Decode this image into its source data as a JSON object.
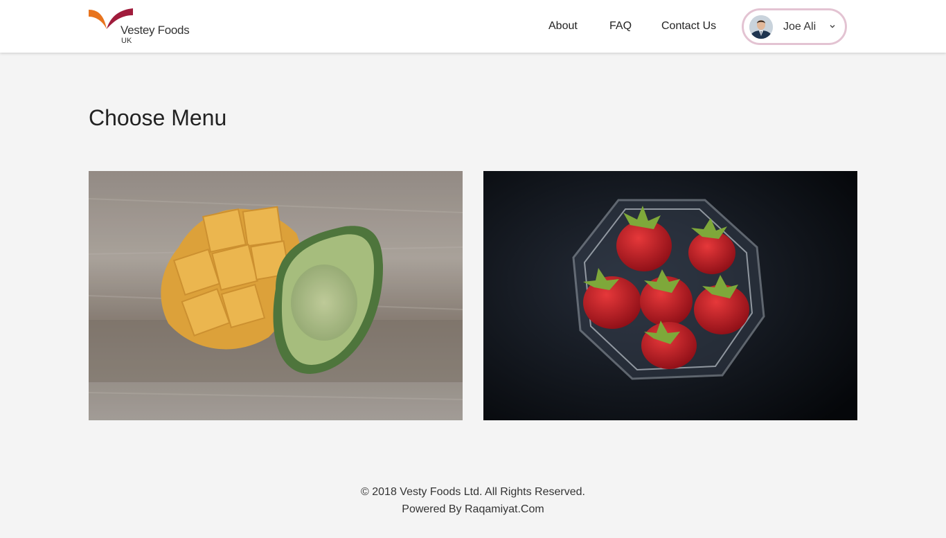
{
  "header": {
    "logo": {
      "name": "Vestey Foods",
      "sub": "UK"
    },
    "nav": [
      {
        "label": "About"
      },
      {
        "label": "FAQ"
      },
      {
        "label": "Contact Us"
      }
    ],
    "user": {
      "name": "Joe Ali",
      "avatar_icon": "user-avatar",
      "dropdown_icon": "chevron-down-icon"
    }
  },
  "main": {
    "title": "Choose Menu",
    "cards": [
      {
        "image": "mango-avocado-photo"
      },
      {
        "image": "strawberries-bowl-photo"
      }
    ]
  },
  "footer": {
    "copyright": "© 2018 Vesty Foods Ltd. All Rights Reserved.",
    "powered": "Powered By Raqamiyat.Com"
  },
  "colors": {
    "header_bg": "#ffffff",
    "page_bg": "#f4f4f4",
    "logo_orange": "#e8741e",
    "logo_maroon": "#a01c3c",
    "user_pill_border": "#e3c3d2"
  }
}
